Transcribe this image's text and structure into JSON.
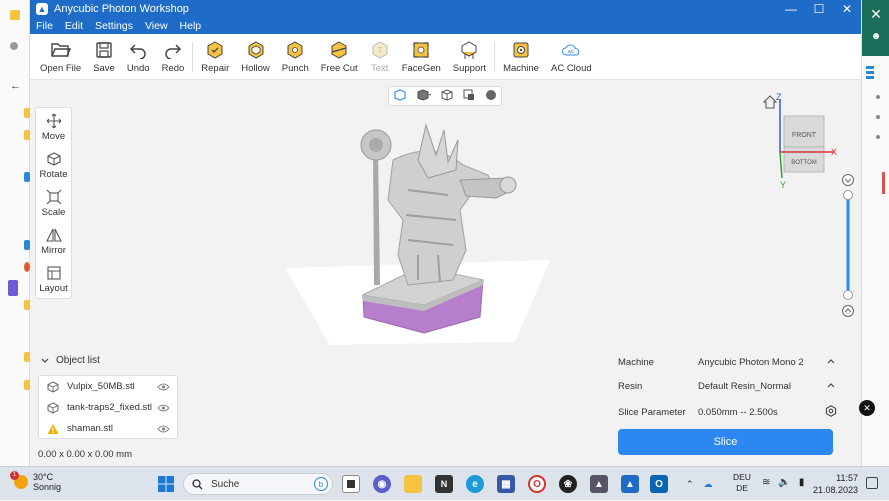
{
  "window": {
    "title": "Anycubic Photon Workshop",
    "controls": [
      "—",
      "☐",
      "✕"
    ]
  },
  "menu": [
    "File",
    "Edit",
    "Settings",
    "View",
    "Help"
  ],
  "toolbar": [
    {
      "label": "Open File",
      "icon": "folder-open-icon"
    },
    {
      "label": "Save",
      "icon": "save-icon"
    },
    {
      "label": "Undo",
      "icon": "undo-icon"
    },
    {
      "label": "Redo",
      "icon": "redo-icon"
    },
    {
      "label": "Repair",
      "icon": "repair-icon"
    },
    {
      "label": "Hollow",
      "icon": "hollow-icon"
    },
    {
      "label": "Punch",
      "icon": "punch-icon"
    },
    {
      "label": "Free Cut",
      "icon": "free-cut-icon"
    },
    {
      "label": "Text",
      "icon": "text-icon",
      "disabled": true
    },
    {
      "label": "FaceGen",
      "icon": "facegen-icon"
    },
    {
      "label": "Support",
      "icon": "support-icon"
    },
    {
      "label": "Machine",
      "icon": "machine-icon"
    },
    {
      "label": "AC Cloud",
      "icon": "cloud-icon"
    }
  ],
  "side_tools": [
    {
      "label": "Move",
      "icon": "move-icon"
    },
    {
      "label": "Rotate",
      "icon": "rotate-icon"
    },
    {
      "label": "Scale",
      "icon": "scale-icon"
    },
    {
      "label": "Mirror",
      "icon": "mirror-icon"
    },
    {
      "label": "Layout",
      "icon": "layout-icon"
    }
  ],
  "view_cube": {
    "front": "FRONT",
    "bottom": "BOTTOM",
    "x": "X",
    "y": "Y",
    "z": "Z"
  },
  "object_list": {
    "title": "Object list",
    "items": [
      {
        "name": "Vulpix_50MB.stl",
        "warning": false
      },
      {
        "name": "tank-traps2_fixed.stl",
        "warning": false
      },
      {
        "name": "shaman.stl",
        "warning": true
      }
    ],
    "dimensions": "0.00 x 0.00 x 0.00 mm"
  },
  "slice_panel": {
    "machine_label": "Machine",
    "machine_value": "Anycubic Photon Mono 2",
    "resin_label": "Resin",
    "resin_value": "Default Resin_Normal",
    "param_label": "Slice Parameter",
    "param_value": "0.050mm -- 2.500s",
    "slice_button": "Slice"
  },
  "taskbar": {
    "weather_temp": "30°C",
    "weather_text": "Sonnig",
    "weather_badge": "1",
    "search_placeholder": "Suche",
    "lang_top": "DEU",
    "lang_bottom": "DE",
    "time": "11:57",
    "date": "21.08.2023"
  },
  "colors": {
    "titlebar": "#1f6cc8",
    "accent_button": "#2d87f0",
    "model_base": "#b77fcb",
    "model": "#c8c8c8"
  }
}
